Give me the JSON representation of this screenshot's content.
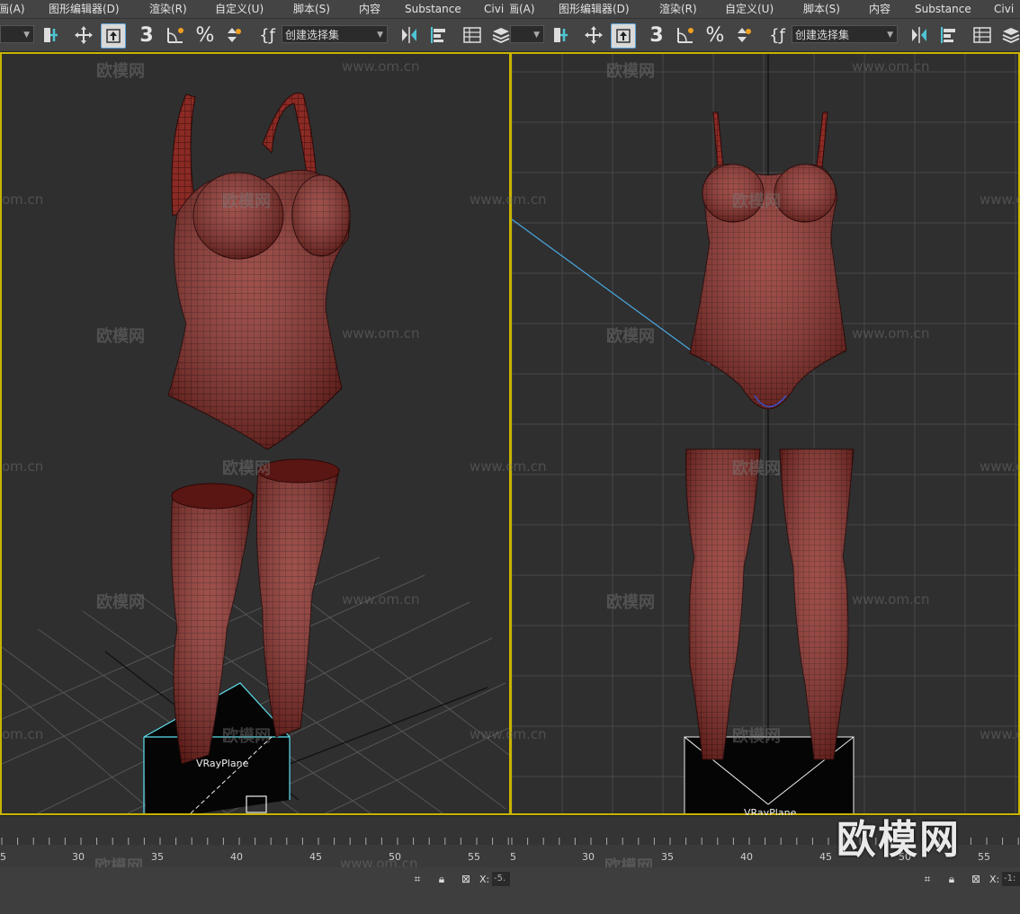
{
  "left_pane": {
    "menu": [
      "画(A)",
      "图形编辑器(D)",
      "渲染(R)",
      "自定义(U)",
      "脚本(S)",
      "内容",
      "Substance",
      "Civi"
    ],
    "selection_set_placeholder": "创建选择集",
    "viewport_label": "VRayPlane",
    "ruler_numbers": [
      "5",
      "30",
      "35",
      "40",
      "45",
      "50",
      "55"
    ],
    "coord_label": "X:",
    "coord_value": "-5."
  },
  "right_pane": {
    "menu": [
      "画(A)",
      "图形编辑器(D)",
      "渲染(R)",
      "自定义(U)",
      "脚本(S)",
      "内容",
      "Substance",
      "Civi"
    ],
    "selection_set_placeholder": "创建选择集",
    "viewport_label": "VRayPlane",
    "ruler_numbers": [
      "5",
      "30",
      "35",
      "40",
      "45",
      "50",
      "55"
    ],
    "coord_label": "X:",
    "coord_value": "-1:"
  },
  "watermarks": {
    "cn": "欧模网",
    "url": "www.om.cn",
    "domain_fragment": "om.cn"
  },
  "big_watermark": "欧模网",
  "icons": [
    "snap-toggle-icon",
    "move-icon",
    "select-object-icon",
    "3d-snap-icon",
    "angle-snap-icon",
    "percent-snap-icon",
    "spinner-snap-icon",
    "edit-named-selection-icon",
    "mirror-icon",
    "align-icon",
    "scene-explorer-icon",
    "layer-explorer-icon",
    "lock-icon",
    "selection-lock-icon"
  ],
  "colors": {
    "viewport_border": "#c8b400",
    "garment": "#8e2e28",
    "mesh_line": "#3a0e0c",
    "grid": "#4a4a4a",
    "selection_cyan": "#5ee0ee"
  }
}
